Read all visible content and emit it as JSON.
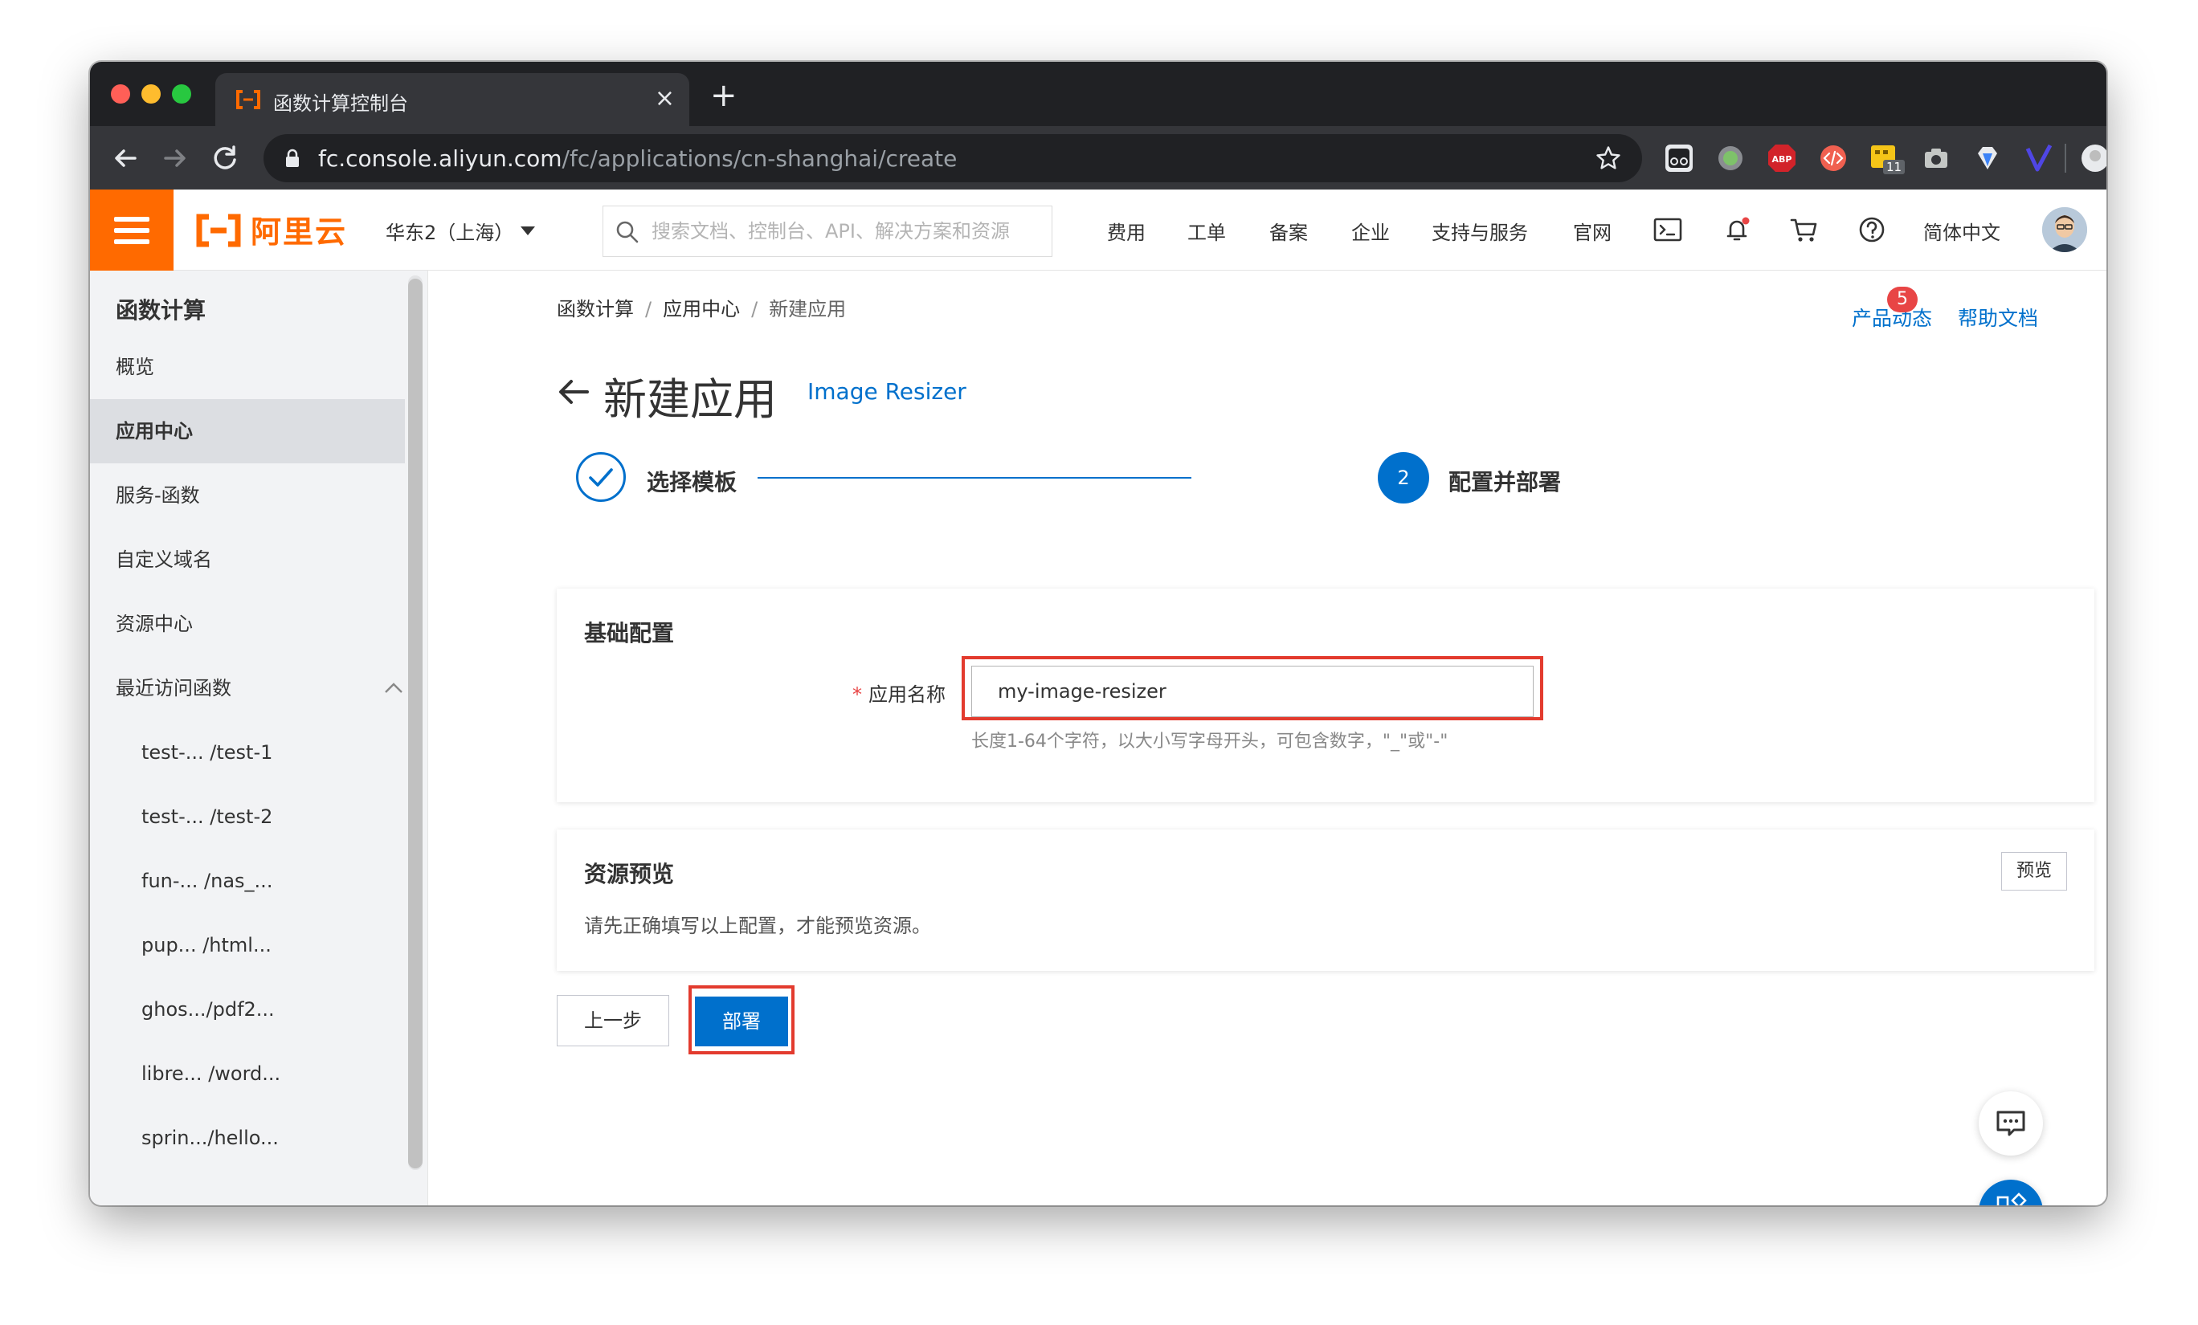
{
  "browser": {
    "tab_title": "函数计算控制台",
    "tab_close": "×",
    "new_tab": "+",
    "url_host": "fc.console.aliyun.com",
    "url_path": "/fc/applications/cn-shanghai/create",
    "ext_badge_count": "11",
    "ext_abp_label": "ABP"
  },
  "header": {
    "logo_text": "阿里云",
    "region": "华东2（上海）",
    "search_placeholder": "搜索文档、控制台、API、解决方案和资源",
    "nav": [
      "费用",
      "工单",
      "备案",
      "企业",
      "支持与服务",
      "官网"
    ],
    "language": "简体中文"
  },
  "sidebar": {
    "title": "函数计算",
    "items": [
      "概览",
      "应用中心",
      "服务-函数",
      "自定义域名",
      "资源中心",
      "最近访问函数"
    ],
    "recent": [
      "test-... /test-1",
      "test-... /test-2",
      "fun-...  /nas_...",
      "pup...  /html...",
      "ghos.../pdf2...",
      "libre...  /word...",
      "sprin.../hello..."
    ]
  },
  "breadcrumb": [
    "函数计算",
    "应用中心",
    "新建应用"
  ],
  "top_links": {
    "product_news": "产品动态",
    "news_badge": "5",
    "help_docs": "帮助文档"
  },
  "page": {
    "title": "新建应用",
    "subtitle": "Image Resizer"
  },
  "steps": {
    "step1_label": "选择模板",
    "step2_number": "2",
    "step2_label": "配置并部署"
  },
  "basic_config": {
    "title": "基础配置",
    "required_mark": "*",
    "name_label": "应用名称",
    "name_value": "my-image-resizer",
    "name_hint": "长度1-64个字符，以大小写字母开头，可包含数字，\"_\"或\"-\""
  },
  "resource_preview": {
    "title": "资源预览",
    "preview_button": "预览",
    "description": "请先正确填写以上配置，才能预览资源。"
  },
  "actions": {
    "prev_label": "上一步",
    "deploy_label": "部署"
  },
  "colors": {
    "brand_orange": "#ff6a00",
    "primary_blue": "#0070cc",
    "highlight_red": "#e33b2e"
  }
}
